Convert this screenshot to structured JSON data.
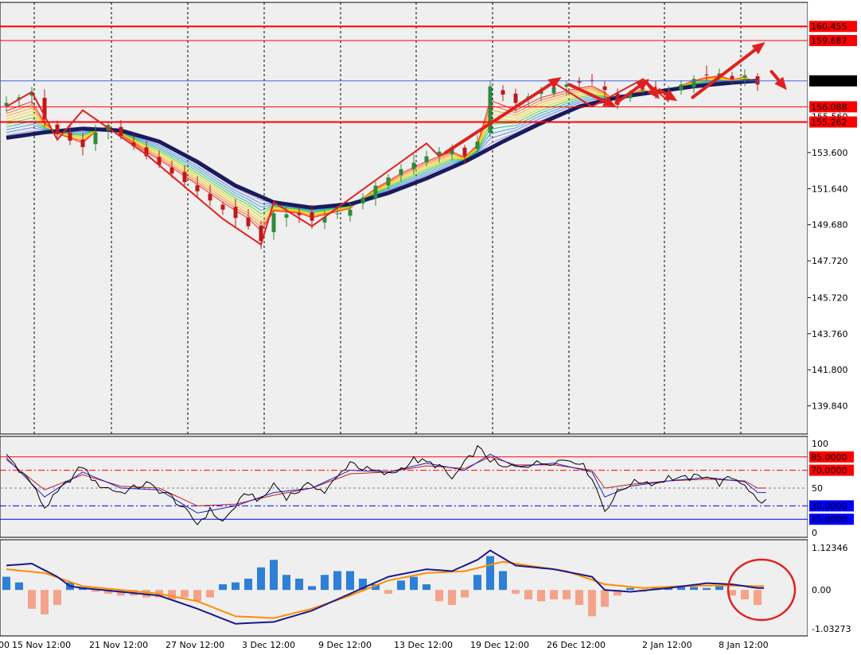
{
  "colors": {
    "background": "#ffffff",
    "panel_bg": "#efefef",
    "grid": "#000000",
    "bull": "#2e8b3c",
    "bear": "#c01818",
    "level_line": "#ff0000",
    "level_label_bg": "#ff0000",
    "current_label_bg": "#000000",
    "current_line": "#4169e1",
    "ribbon_slow": "#1a1a5e",
    "zigzag": "#e02020",
    "stoch_main": "#000000",
    "stoch_blue": "#2020c0",
    "stoch_red": "#c02020",
    "macd_line": "#1a1a8a",
    "macd_signal": "#ff8c00",
    "hist_pos": "#2e7fd6",
    "hist_neg": "#f4a38a",
    "circle": "#e02020"
  },
  "chart_data": [
    {
      "type": "candlestick",
      "panel": "price",
      "y_ticks": [
        "153.600",
        "151.640",
        "149.680",
        "147.720",
        "145.720",
        "143.760",
        "141.800",
        "139.840"
      ],
      "ylim": [
        139.0,
        161.2
      ],
      "x_labels": [
        "15 Nov 12:00",
        "21 Nov 12:00",
        "27 Nov 12:00",
        "3 Dec 12:00",
        "9 Dec 12:00",
        "13 Dec 12:00",
        "19 Dec 12:00",
        "26 Dec 12:00",
        "2 Jan 12:00",
        "8 Jan 12:00"
      ],
      "left_edge_label": "00",
      "levels": [
        {
          "label": "160.455",
          "value": 160.455,
          "style": "red"
        },
        {
          "label": "159.687",
          "value": 159.687,
          "style": "red"
        },
        {
          "label": "156.088",
          "value": 156.088,
          "style": "red"
        },
        {
          "label": "155.560",
          "value": 155.56,
          "style": "plain"
        },
        {
          "label": "155.262",
          "value": 155.262,
          "style": "red"
        }
      ],
      "current_price": {
        "label": "157.497",
        "value": 157.497
      },
      "price_anchors": [
        [
          0,
          156.3
        ],
        [
          2,
          156.9
        ],
        [
          3,
          155.4
        ],
        [
          4,
          154.6
        ],
        [
          6,
          153.9
        ],
        [
          7,
          154.7
        ],
        [
          8,
          155.1
        ],
        [
          9,
          154.5
        ],
        [
          11,
          153.4
        ],
        [
          14,
          152.0
        ],
        [
          17,
          150.5
        ],
        [
          19,
          149.6
        ],
        [
          20,
          148.8
        ],
        [
          21,
          150.3
        ],
        [
          23,
          150.2
        ],
        [
          24,
          149.9
        ],
        [
          25,
          150.1
        ],
        [
          27,
          150.5
        ],
        [
          29,
          151.8
        ],
        [
          31,
          152.7
        ],
        [
          33,
          153.4
        ],
        [
          35,
          153.9
        ],
        [
          36,
          153.4
        ],
        [
          37,
          154.2
        ],
        [
          38,
          157.2
        ],
        [
          40,
          156.3
        ],
        [
          42,
          157.0
        ],
        [
          44,
          157.3
        ],
        [
          46,
          157.5
        ],
        [
          47,
          157.0
        ],
        [
          48,
          156.2
        ],
        [
          49,
          156.8
        ],
        [
          50,
          157.1
        ],
        [
          51,
          156.7
        ],
        [
          52,
          156.9
        ],
        [
          53,
          157.3
        ],
        [
          54,
          157.6
        ],
        [
          55,
          157.8
        ],
        [
          56,
          157.9
        ],
        [
          57,
          157.6
        ],
        [
          58,
          157.8
        ],
        [
          59,
          157.3
        ]
      ],
      "ribbon_slow_anchors": [
        [
          0,
          154.4
        ],
        [
          3,
          154.7
        ],
        [
          6,
          154.9
        ],
        [
          9,
          154.8
        ],
        [
          12,
          154.2
        ],
        [
          15,
          153.1
        ],
        [
          18,
          151.8
        ],
        [
          21,
          150.9
        ],
        [
          24,
          150.6
        ],
        [
          27,
          150.8
        ],
        [
          30,
          151.4
        ],
        [
          33,
          152.2
        ],
        [
          36,
          153.1
        ],
        [
          39,
          154.2
        ],
        [
          42,
          155.2
        ],
        [
          45,
          156.1
        ],
        [
          48,
          156.6
        ],
        [
          51,
          156.9
        ],
        [
          54,
          157.2
        ],
        [
          57,
          157.4
        ],
        [
          59,
          157.5
        ]
      ],
      "zigzag": [
        [
          0,
          156.1
        ],
        [
          2,
          156.9
        ],
        [
          4,
          154.3
        ],
        [
          6,
          155.9
        ],
        [
          11,
          153.5
        ],
        [
          17,
          150.0
        ],
        [
          20,
          148.6
        ],
        [
          21,
          150.9
        ],
        [
          24,
          149.6
        ],
        [
          33,
          154.1
        ],
        [
          34,
          153.4
        ],
        [
          43,
          157.4
        ],
        [
          46,
          156.1
        ],
        [
          50,
          157.6
        ],
        [
          52,
          156.4
        ]
      ],
      "arrows": [
        {
          "from": [
            34.5,
            153.6
          ],
          "to": [
            43.6,
            157.7
          ]
        },
        {
          "from": [
            44.2,
            157.3
          ],
          "to": [
            47.9,
            156.1
          ]
        },
        {
          "from": [
            47.9,
            156.3
          ],
          "to": [
            50.5,
            157.6
          ]
        },
        {
          "from": [
            50.3,
            157.4
          ],
          "to": [
            51.3,
            156.5
          ]
        },
        {
          "from": [
            51.3,
            157.0
          ],
          "to": [
            52.7,
            156.4
          ]
        },
        {
          "from": [
            53.9,
            156.6
          ],
          "to": [
            59.6,
            159.6
          ]
        },
        {
          "from": [
            60.1,
            158.0
          ],
          "to": [
            61.3,
            157.0
          ]
        }
      ]
    },
    {
      "type": "line",
      "panel": "stochastic",
      "ylim": [
        0,
        100
      ],
      "y_ticks": [
        "100",
        "50",
        "0"
      ],
      "levels": [
        {
          "label": "85.0000",
          "value": 85,
          "style": "red"
        },
        {
          "label": "70.0000",
          "value": 70,
          "style": "red-dash"
        },
        {
          "label": "30.0000",
          "value": 30,
          "style": "blue-dash"
        },
        {
          "label": "15.0000",
          "value": 15,
          "style": "blue"
        }
      ],
      "k_anchors": [
        [
          0,
          88
        ],
        [
          2,
          55
        ],
        [
          3,
          28
        ],
        [
          5,
          60
        ],
        [
          6,
          75
        ],
        [
          7,
          55
        ],
        [
          9,
          45
        ],
        [
          11,
          55
        ],
        [
          13,
          40
        ],
        [
          14,
          25
        ],
        [
          15,
          10
        ],
        [
          16,
          25
        ],
        [
          17,
          12
        ],
        [
          18,
          30
        ],
        [
          19,
          45
        ],
        [
          20,
          35
        ],
        [
          21,
          55
        ],
        [
          22,
          40
        ],
        [
          24,
          55
        ],
        [
          25,
          45
        ],
        [
          26,
          62
        ],
        [
          27,
          80
        ],
        [
          28,
          72
        ],
        [
          30,
          65
        ],
        [
          31,
          72
        ],
        [
          32,
          82
        ],
        [
          34,
          75
        ],
        [
          35,
          60
        ],
        [
          37,
          95
        ],
        [
          38,
          82
        ],
        [
          39,
          72
        ],
        [
          40,
          75
        ],
        [
          42,
          78
        ],
        [
          44,
          82
        ],
        [
          45,
          80
        ],
        [
          46,
          62
        ],
        [
          47,
          25
        ],
        [
          48,
          45
        ],
        [
          49,
          55
        ],
        [
          50,
          58
        ],
        [
          51,
          55
        ],
        [
          52,
          62
        ],
        [
          53,
          60
        ],
        [
          54,
          62
        ],
        [
          55,
          65
        ],
        [
          56,
          55
        ],
        [
          57,
          62
        ],
        [
          58,
          55
        ],
        [
          59,
          35
        ]
      ],
      "d_anchors": [
        [
          0,
          84
        ],
        [
          3,
          40
        ],
        [
          6,
          68
        ],
        [
          9,
          50
        ],
        [
          12,
          48
        ],
        [
          15,
          22
        ],
        [
          18,
          30
        ],
        [
          21,
          45
        ],
        [
          24,
          50
        ],
        [
          27,
          70
        ],
        [
          30,
          68
        ],
        [
          33,
          78
        ],
        [
          36,
          70
        ],
        [
          38,
          88
        ],
        [
          40,
          74
        ],
        [
          43,
          78
        ],
        [
          46,
          68
        ],
        [
          47,
          40
        ],
        [
          49,
          52
        ],
        [
          52,
          58
        ],
        [
          55,
          62
        ],
        [
          58,
          57
        ],
        [
          59,
          45
        ]
      ],
      "slow_anchors": [
        [
          0,
          82
        ],
        [
          3,
          48
        ],
        [
          6,
          65
        ],
        [
          9,
          52
        ],
        [
          12,
          50
        ],
        [
          15,
          30
        ],
        [
          18,
          32
        ],
        [
          21,
          42
        ],
        [
          24,
          50
        ],
        [
          27,
          66
        ],
        [
          30,
          68
        ],
        [
          33,
          75
        ],
        [
          36,
          72
        ],
        [
          38,
          85
        ],
        [
          40,
          76
        ],
        [
          43,
          76
        ],
        [
          46,
          70
        ],
        [
          47,
          50
        ],
        [
          49,
          54
        ],
        [
          52,
          58
        ],
        [
          55,
          60
        ],
        [
          58,
          58
        ],
        [
          59,
          50
        ]
      ]
    },
    {
      "type": "bar",
      "panel": "macd",
      "ylim": [
        -1.03273,
        1.12346
      ],
      "y_ticks": [
        "1.12346",
        "0.00",
        "-1.03273"
      ],
      "histogram": [
        0.35,
        0.2,
        -0.5,
        -0.65,
        -0.4,
        0.2,
        0.05,
        -0.05,
        -0.1,
        -0.15,
        -0.15,
        -0.2,
        -0.2,
        -0.25,
        -0.2,
        -0.3,
        -0.2,
        0.15,
        0.2,
        0.3,
        0.6,
        0.8,
        0.4,
        0.3,
        0.1,
        0.4,
        0.5,
        0.5,
        0.3,
        0.15,
        -0.1,
        0.25,
        0.35,
        0.15,
        -0.3,
        -0.4,
        -0.2,
        0.4,
        0.9,
        0.5,
        -0.1,
        -0.25,
        -0.3,
        -0.25,
        -0.25,
        -0.4,
        -0.7,
        -0.45,
        -0.15,
        0.05,
        -0.05,
        0.08,
        0.05,
        0.12,
        0.08,
        0.05,
        0.1,
        -0.15,
        -0.25,
        -0.4
      ],
      "macd_anchors": [
        [
          0,
          0.65
        ],
        [
          2,
          0.7
        ],
        [
          4,
          0.35
        ],
        [
          5,
          0.1
        ],
        [
          6,
          0.05
        ],
        [
          9,
          -0.05
        ],
        [
          12,
          -0.15
        ],
        [
          15,
          -0.5
        ],
        [
          18,
          -0.9
        ],
        [
          21,
          -0.85
        ],
        [
          24,
          -0.55
        ],
        [
          27,
          -0.1
        ],
        [
          30,
          0.35
        ],
        [
          33,
          0.55
        ],
        [
          35,
          0.5
        ],
        [
          37,
          0.8
        ],
        [
          38,
          1.05
        ],
        [
          40,
          0.65
        ],
        [
          43,
          0.55
        ],
        [
          46,
          0.35
        ],
        [
          47,
          0.0
        ],
        [
          49,
          -0.05
        ],
        [
          52,
          0.05
        ],
        [
          55,
          0.18
        ],
        [
          57,
          0.15
        ],
        [
          59,
          0.05
        ]
      ],
      "signal_anchors": [
        [
          0,
          0.55
        ],
        [
          3,
          0.45
        ],
        [
          6,
          0.1
        ],
        [
          9,
          0.0
        ],
        [
          12,
          -0.1
        ],
        [
          15,
          -0.3
        ],
        [
          18,
          -0.7
        ],
        [
          21,
          -0.75
        ],
        [
          24,
          -0.5
        ],
        [
          27,
          -0.15
        ],
        [
          30,
          0.25
        ],
        [
          33,
          0.45
        ],
        [
          36,
          0.5
        ],
        [
          39,
          0.75
        ],
        [
          41,
          0.65
        ],
        [
          44,
          0.5
        ],
        [
          47,
          0.15
        ],
        [
          50,
          0.05
        ],
        [
          53,
          0.1
        ],
        [
          56,
          0.12
        ],
        [
          59,
          0.1
        ]
      ]
    }
  ]
}
